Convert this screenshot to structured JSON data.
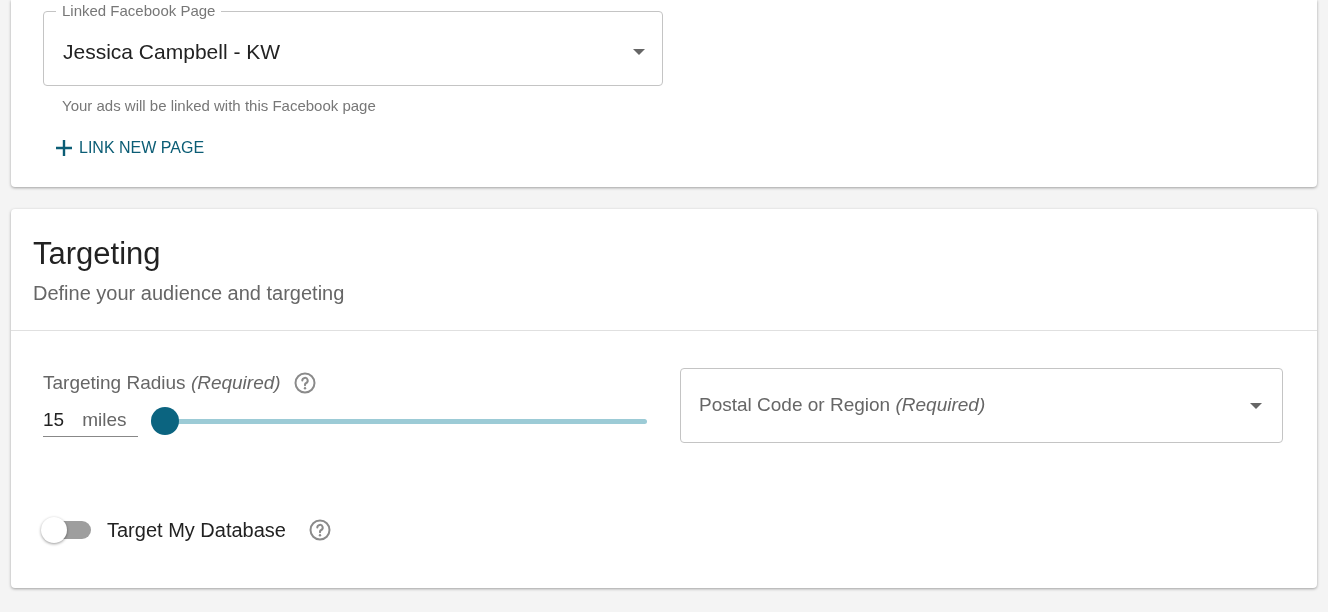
{
  "facebook_page": {
    "label": "Linked Facebook Page",
    "value": "Jessica Campbell - KW",
    "helper": "Your ads will be linked with this Facebook page",
    "link_button": "LINK NEW PAGE"
  },
  "targeting": {
    "title": "Targeting",
    "subtitle": "Define your audience and targeting",
    "radius": {
      "label": "Targeting Radius *(Required)*",
      "value": "15",
      "unit": "miles",
      "level": 0
    },
    "postal": {
      "placeholder": "Postal Code or Region *(Required)*"
    },
    "database_toggle": {
      "label": "Target My Database",
      "on": false
    }
  }
}
